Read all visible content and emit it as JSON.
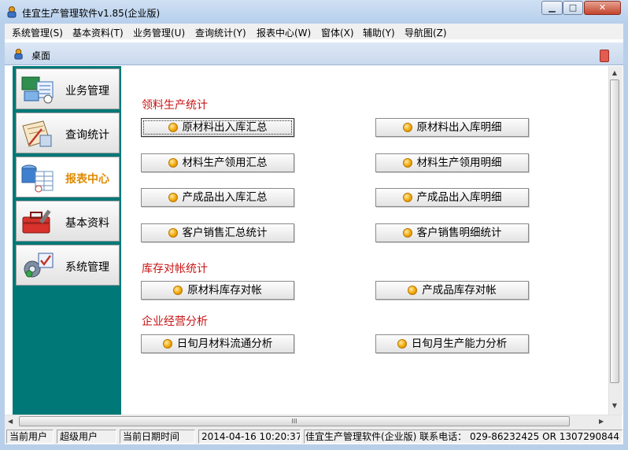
{
  "window": {
    "title": "佳宜生产管理软件v1.85(企业版)",
    "min_glyph": "▁",
    "max_glyph": "□",
    "close_glyph": "✕"
  },
  "menu": [
    {
      "label": "系统管理(S)"
    },
    {
      "label": "基本资料(T)"
    },
    {
      "label": "业务管理(U)"
    },
    {
      "label": "查询统计(Y)"
    },
    {
      "label": "报表中心(W)"
    },
    {
      "label": "窗体(X)"
    },
    {
      "label": "辅助(Y)"
    },
    {
      "label": "导航图(Z)"
    }
  ],
  "desktop": {
    "label": "桌面"
  },
  "nav": [
    {
      "label": "业务管理",
      "icon": "business-icon",
      "active": false
    },
    {
      "label": "查询统计",
      "icon": "query-icon",
      "active": false
    },
    {
      "label": "报表中心",
      "icon": "report-icon",
      "active": true
    },
    {
      "label": "基本资料",
      "icon": "toolbox-icon",
      "active": false
    },
    {
      "label": "系统管理",
      "icon": "system-gear-icon",
      "active": false
    }
  ],
  "sections": {
    "production": {
      "title": "领料生产统计",
      "buttons": [
        {
          "label": "原材料出入库汇总"
        },
        {
          "label": "原材料出入库明细"
        },
        {
          "label": "材料生产领用汇总"
        },
        {
          "label": "材料生产领用明细"
        },
        {
          "label": "产成品出入库汇总"
        },
        {
          "label": "产成品出入库明细"
        },
        {
          "label": "客户销售汇总统计"
        },
        {
          "label": "客户销售明细统计"
        }
      ]
    },
    "inventory": {
      "title": "库存对帐统计",
      "buttons": [
        {
          "label": "原材料库存对帐"
        },
        {
          "label": "产成品库存对帐"
        }
      ]
    },
    "analysis": {
      "title": "企业经营分析",
      "buttons": [
        {
          "label": "日旬月材料流通分析"
        },
        {
          "label": "日旬月生产能力分析"
        }
      ]
    }
  },
  "scroll": {
    "up": "▲",
    "down": "▼",
    "left": "◀",
    "right": "▶",
    "grip": "III"
  },
  "status": {
    "user_label": "当前用户",
    "user_value": "超级用户",
    "date_label": "当前日期时间",
    "date_value": "2014-04-16 10:20:37",
    "info": "佳宜生产管理软件(企业版)  联系电话：  029-86232425 OR 1307290844"
  },
  "colors": {
    "nav_bg": "#007878",
    "section_title": "#c81414",
    "active_nav": "#e08a00"
  }
}
